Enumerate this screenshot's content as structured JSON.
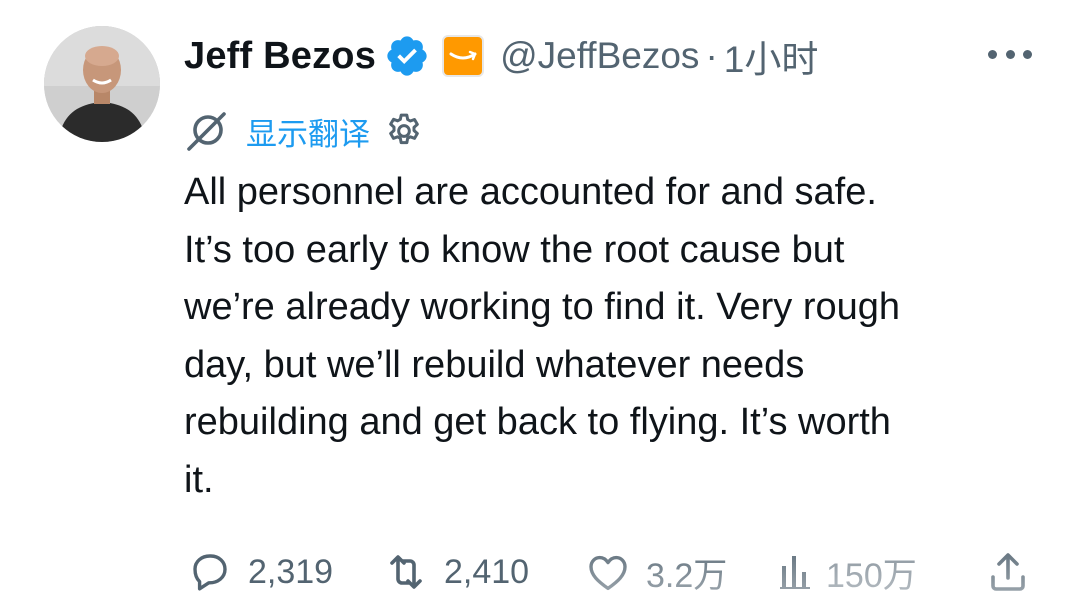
{
  "author": {
    "display_name": "Jeff Bezos",
    "handle": "@JeffBezos",
    "separator": "·",
    "time": "1小时",
    "verified_icon": "verified-badge-icon",
    "affiliate_icon": "amazon-logo-icon"
  },
  "translate": {
    "label": "显示翻译",
    "icon": "translate-icon",
    "settings_icon": "gear-icon"
  },
  "tweet": {
    "lines": [
      "All personnel are accounted for and safe.",
      "It’s too early to know the root cause but",
      "we’re already working to find it. Very rough",
      "day, but we’ll rebuild whatever needs",
      "rebuilding and get back to flying. It’s worth",
      "it."
    ]
  },
  "actions": {
    "replies": "2,319",
    "reposts": "2,410",
    "likes": "3.2万",
    "views": "150万"
  },
  "colors": {
    "text": "#0f1419",
    "secondary": "#536471",
    "link": "#1d9bf0",
    "verified": "#1d9bf0",
    "amazon": "#ff9900"
  }
}
